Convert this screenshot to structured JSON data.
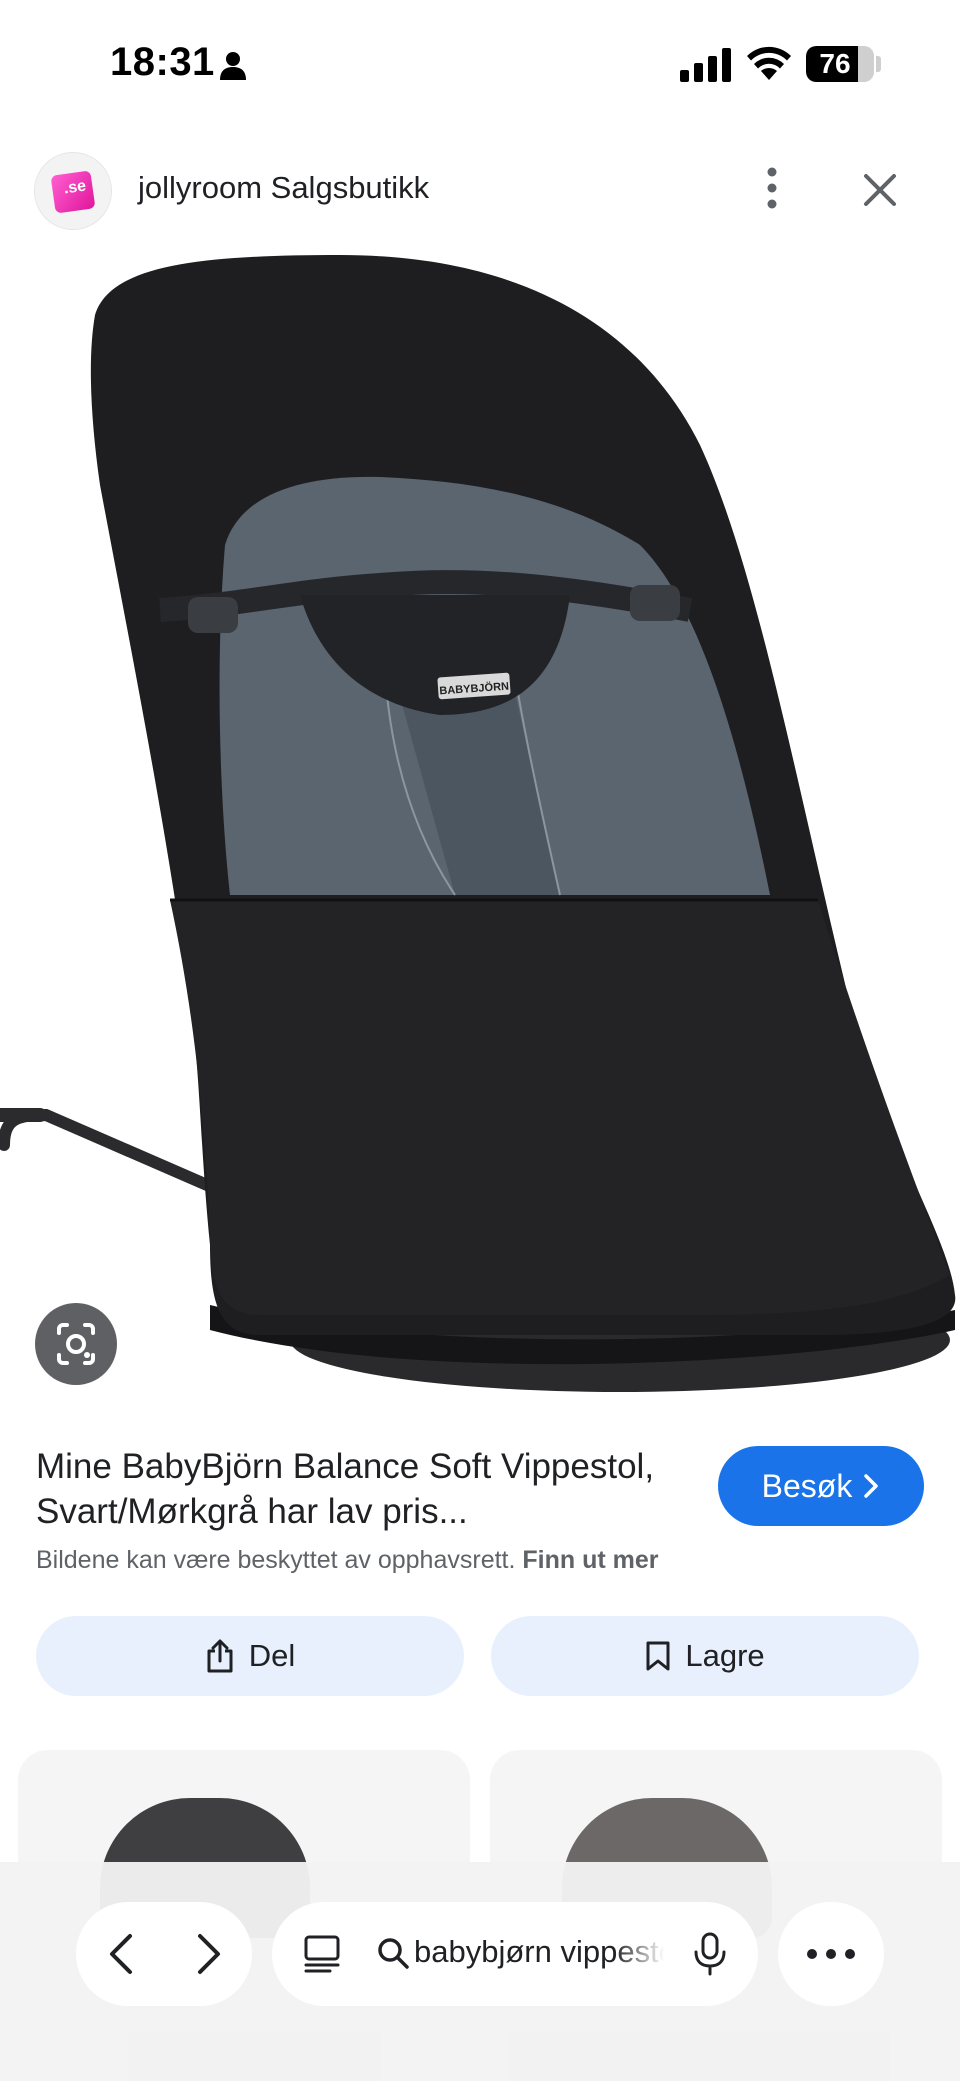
{
  "status_bar": {
    "time": "18:31",
    "battery_level": "76",
    "battery_fraction": 0.76
  },
  "header": {
    "site_name": "jollyroom Salgsbutikk",
    "logo_text": ".se",
    "icons": [
      "more-vertical-icon",
      "close-icon"
    ]
  },
  "product": {
    "title": "Mine BabyBjörn Balance Soft Vippestol, Svart/Mørkgrå har lav pris...",
    "visit_label": "Besøk",
    "copyright_text": "Bildene kan være beskyttet av opphavsrett.",
    "learn_more": "Finn ut mer",
    "image_brand_label": "BABYBJÖRN"
  },
  "actions": {
    "share_label": "Del",
    "save_label": "Lagre"
  },
  "bottom_bar": {
    "search_text": "babybjørn vippestol",
    "icons": [
      "back-icon",
      "forward-icon",
      "tabs-icon",
      "search-icon",
      "mic-icon",
      "more-horizontal-icon"
    ]
  },
  "colors": {
    "accent": "#1a73e8",
    "action_bg": "#e8f0fe",
    "fabric_black": "#1f1f21",
    "fabric_grey": "#5b6670"
  }
}
